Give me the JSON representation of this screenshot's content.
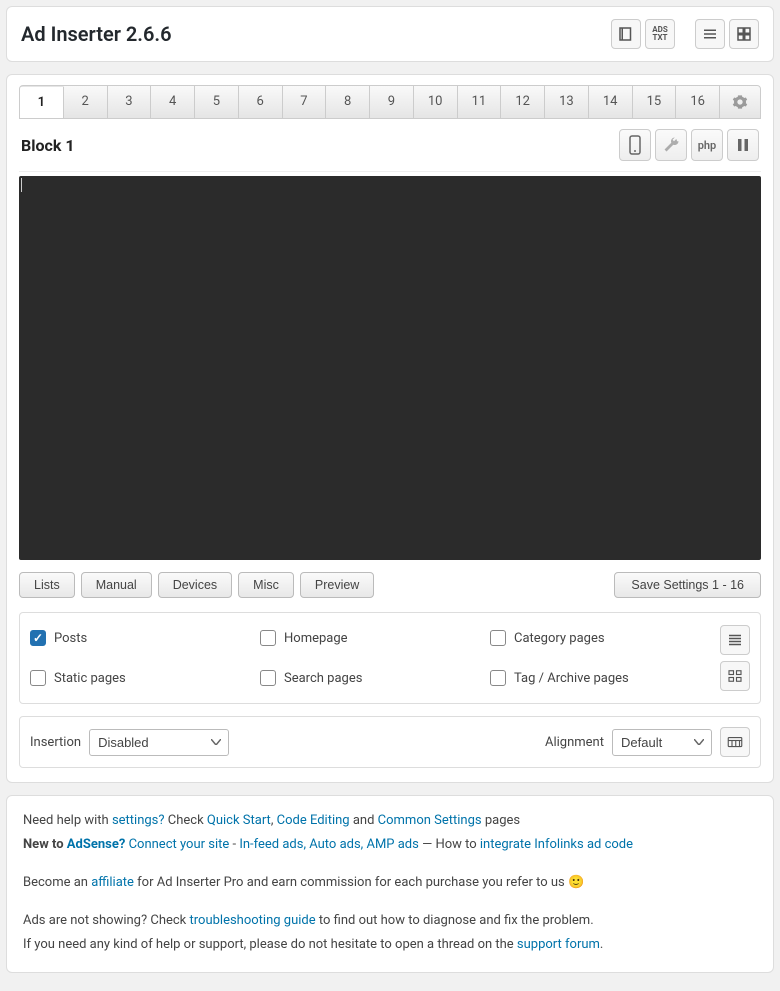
{
  "header": {
    "title": "Ad Inserter 2.6.6"
  },
  "tabs": [
    "1",
    "2",
    "3",
    "4",
    "5",
    "6",
    "7",
    "8",
    "9",
    "10",
    "11",
    "12",
    "13",
    "14",
    "15",
    "16"
  ],
  "active_tab": 0,
  "block": {
    "name": "Block 1",
    "php_btn": "php"
  },
  "buttons": {
    "lists": "Lists",
    "manual": "Manual",
    "devices": "Devices",
    "misc": "Misc",
    "preview": "Preview",
    "save": "Save Settings 1 - 16"
  },
  "page_types": {
    "posts": {
      "label": "Posts",
      "checked": true
    },
    "homepage": {
      "label": "Homepage",
      "checked": false
    },
    "category": {
      "label": "Category pages",
      "checked": false
    },
    "static": {
      "label": "Static pages",
      "checked": false
    },
    "search": {
      "label": "Search pages",
      "checked": false
    },
    "tag": {
      "label": "Tag / Archive pages",
      "checked": false
    }
  },
  "insertion": {
    "label": "Insertion",
    "value": "Disabled",
    "alignment_label": "Alignment",
    "alignment_value": "Default"
  },
  "help": {
    "line1_a": "Need help with ",
    "settings": "settings?",
    "line1_b": " Check ",
    "quickstart": "Quick Start",
    "comma": ", ",
    "codeediting": "Code Editing",
    "and": " and ",
    "commonsettings": "Common Settings",
    "pages": " pages",
    "line2_a": "New to ",
    "adsense": "AdSense?",
    "connect": "Connect your site",
    "dash": " - ",
    "infeed": "In-feed ads, Auto ads, AMP ads",
    "howto": " — How to ",
    "integrate": "integrate Infolinks ad code",
    "line3_a": "Become an ",
    "affiliate": "affiliate",
    "line3_b": " for Ad Inserter Pro and earn commission for each purchase you refer to us  🙂",
    "line4_a": "Ads are not showing? Check ",
    "troubleshoot": "troubleshooting guide",
    "line4_b": " to find out how to diagnose and fix the problem.",
    "line5_a": "If you need any kind of help or support, please do not hesitate to open a thread on the ",
    "forum": "support forum",
    "period": "."
  }
}
